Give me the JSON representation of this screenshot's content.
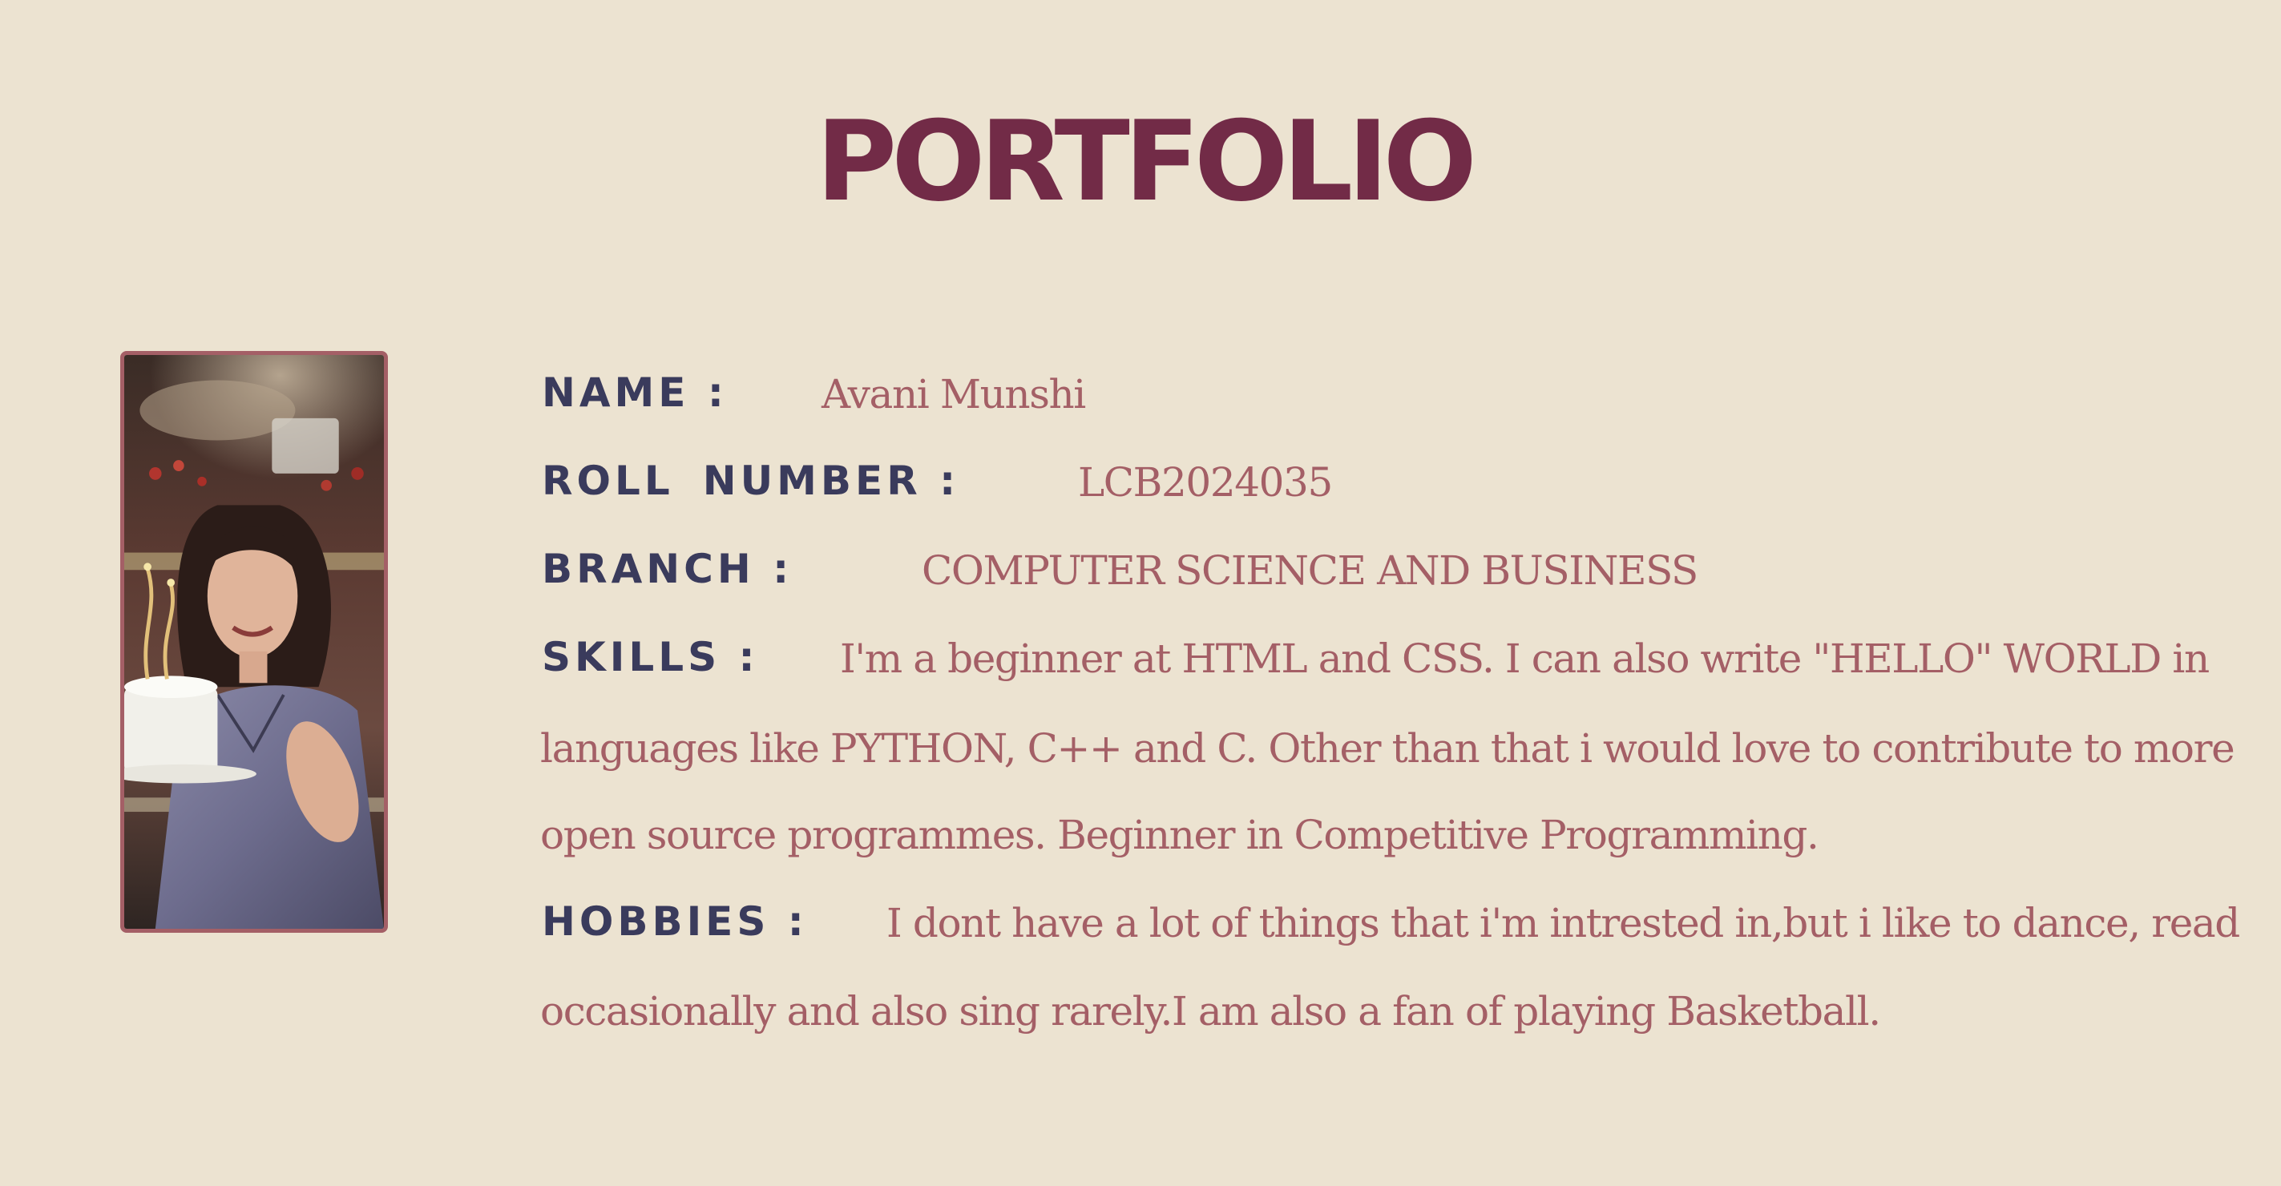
{
  "colors": {
    "background": "#ece3d1",
    "title": "#722b47",
    "label": "#3a3b5c",
    "value": "#a45f66",
    "frame": "#a45f66"
  },
  "header": {
    "title": "PORTFOLIO"
  },
  "profile": {
    "photo_icon": "portrait-photo"
  },
  "details": {
    "name": {
      "label": "NAME :",
      "value": "Avani Munshi"
    },
    "roll": {
      "label_word1": "ROLL",
      "label_word2": "NUMBER :",
      "value": "LCB2024035"
    },
    "branch": {
      "label": "BRANCH :",
      "value": "COMPUTER SCIENCE AND BUSINESS"
    },
    "skills": {
      "label": "SKILLS :",
      "lines": [
        "I'm a beginner at HTML and CSS. I can also write \"HELLO\" WORLD in",
        "languages like PYTHON, C++ and C. Other than that i would love to contribute to more",
        "open source programmes. Beginner in Competitive Programming."
      ]
    },
    "hobbies": {
      "label": "HOBBIES :",
      "lines": [
        "I dont have a lot of things that i'm intrested in,but i like to dance, read",
        "occasionally and also sing rarely.I am also a fan of playing Basketball."
      ]
    }
  }
}
